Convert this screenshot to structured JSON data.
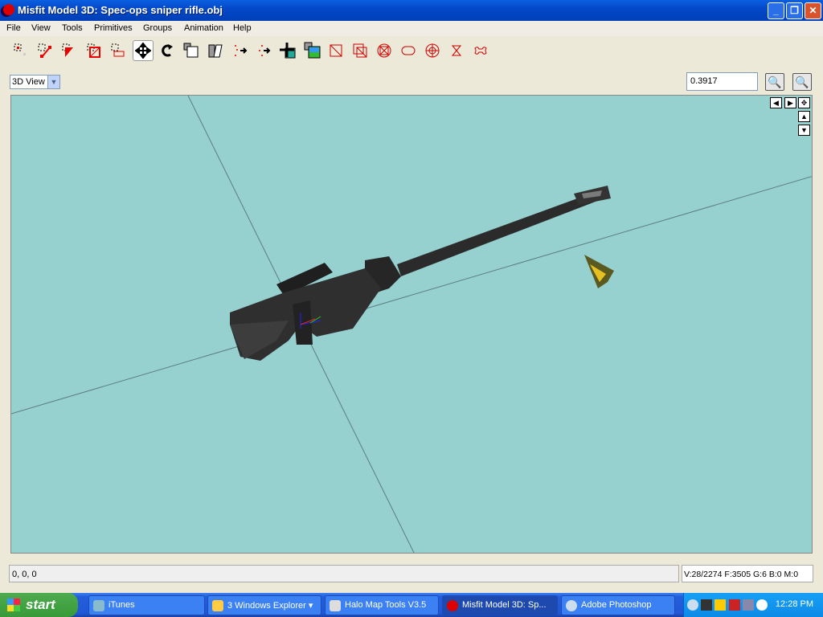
{
  "window": {
    "title": "Misfit Model 3D: Spec-ops sniper rifle.obj"
  },
  "menu": [
    "File",
    "View",
    "Tools",
    "Primitives",
    "Groups",
    "Animation",
    "Help"
  ],
  "toolbar": {
    "tools": [
      "select-vertices-icon",
      "select-faces-icon",
      "select-connected-icon",
      "select-groups-icon",
      "select-bones-icon",
      "move-icon",
      "rotate-icon",
      "scale-icon",
      "shear-icon",
      "extrude-icon",
      "attach-icon",
      "drag-vertex-icon",
      "background-icon",
      "rectangle-icon",
      "cube-icon",
      "ellipsoid-icon",
      "cylinder-icon",
      "torus-icon",
      "polygon-icon",
      "bone-joint-icon"
    ],
    "active": "move-icon"
  },
  "view": {
    "selected": "3D View",
    "zoom": "0.3917"
  },
  "colors": {
    "viewport_bg": "#96d1d0",
    "model": "#2b2b2b"
  },
  "status": {
    "coords": "0, 0, 0",
    "stats": "V:28/2274 F:3505 G:6 B:0 M:0"
  },
  "taskbar": {
    "start": "start",
    "tasks": [
      "iTunes",
      "3 Windows Explorer",
      "Halo Map Tools V3.5",
      "Misfit Model 3D: Sp...",
      "Adobe Photoshop"
    ],
    "clock": "12:28 PM"
  }
}
